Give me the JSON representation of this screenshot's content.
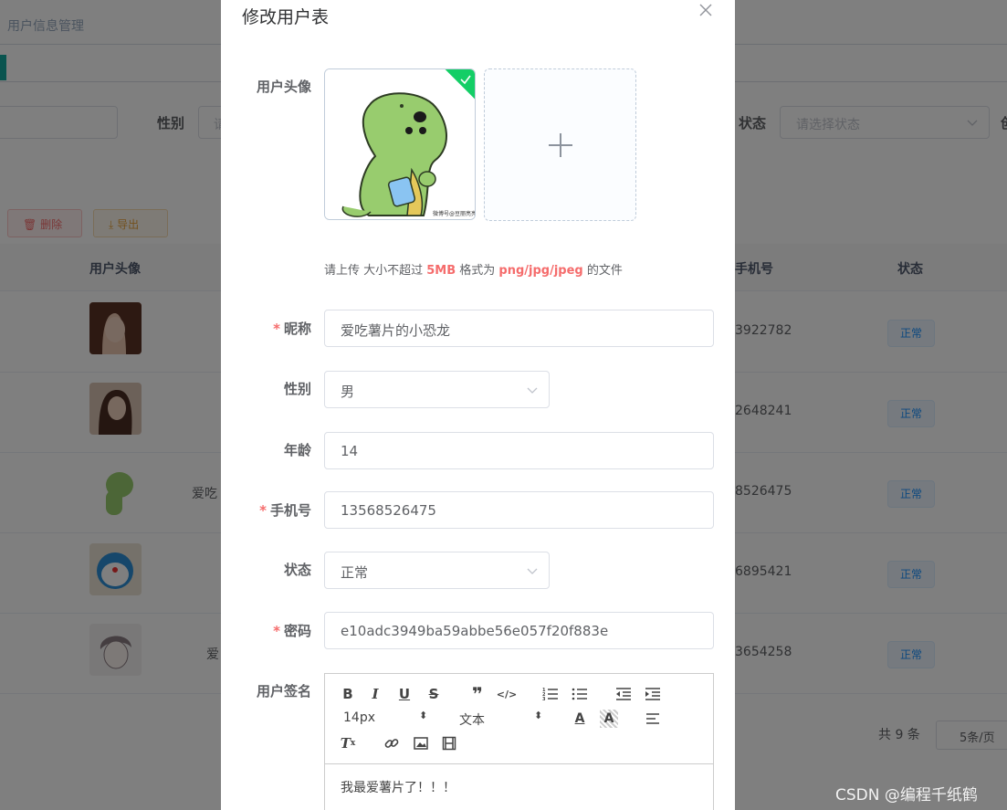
{
  "background": {
    "breadcrumb": "用户信息管理",
    "search": {
      "gender_label": "性别",
      "gender_placeholder": "请",
      "status_label": "状态",
      "status_placeholder": "请选择状态",
      "extra_label": "创"
    },
    "actions": {
      "delete_label": "删除",
      "export_label": "导出"
    },
    "table": {
      "headers": {
        "avatar": "用户头像",
        "phone": "手机号",
        "status": "状态"
      },
      "rows": [
        {
          "name": "",
          "phone": "3922782",
          "status": "正常"
        },
        {
          "name": "",
          "phone": "2648241",
          "status": "正常"
        },
        {
          "name": "爱吃",
          "phone": "8526475",
          "status": "正常"
        },
        {
          "name": "",
          "phone": "6895421",
          "status": "正常"
        },
        {
          "name": "爱",
          "phone": "3654258",
          "status": "正常"
        }
      ]
    },
    "pager": {
      "total": "共 9 条",
      "size": "5条/页"
    }
  },
  "dialog": {
    "title": "修改用户表",
    "avatar_label": "用户头像",
    "upload_tip": {
      "prefix": "请上传 大小不超过 ",
      "size": "5MB",
      "middle": " 格式为 ",
      "formats": "png/jpg/jpeg",
      "suffix": " 的文件"
    },
    "avatar_caption": "微博号@豆丽亮亮",
    "fields": {
      "nickname": {
        "label": "昵称",
        "value": "爱吃薯片的小恐龙"
      },
      "gender": {
        "label": "性别",
        "value": "男"
      },
      "age": {
        "label": "年龄",
        "value": "14"
      },
      "phone": {
        "label": "手机号",
        "value": "13568526475"
      },
      "status": {
        "label": "状态",
        "value": "正常"
      },
      "password": {
        "label": "密码",
        "value": "e10adc3949ba59abbe56e057f20f883e"
      }
    },
    "signature": {
      "label": "用户签名",
      "font_size": "14px",
      "block_type": "文本",
      "content": "我最爱薯片了！！！"
    }
  },
  "watermark": "CSDN @编程千纸鹤",
  "colors": {
    "primary": "#1890ff",
    "danger": "#f56c6c",
    "success": "#13ce66",
    "warning": "#e6a23c",
    "dino": "#98cc6e"
  }
}
